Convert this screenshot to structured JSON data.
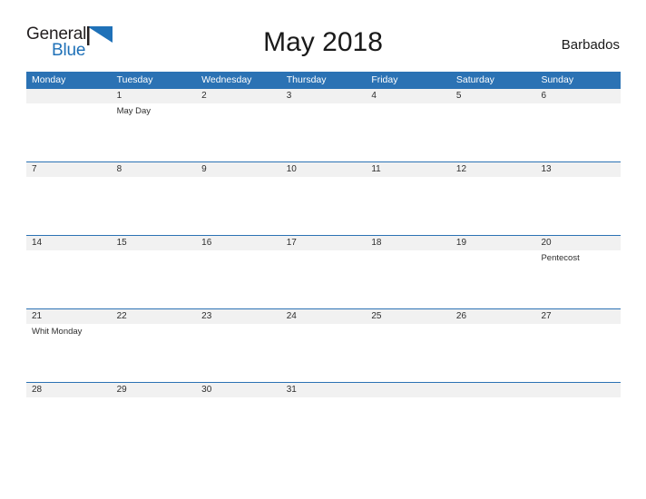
{
  "brand": {
    "name_part1": "General",
    "name_part2": "Blue",
    "color_dark": "#231f20",
    "color_blue": "#1f71b8"
  },
  "header": {
    "title": "May 2018",
    "country": "Barbados"
  },
  "theme": {
    "header_band": "#2b72b4",
    "daynum_band": "#f1f1f1",
    "row_divider": "#2b72b4",
    "text": "#2e2e2e",
    "header_text": "#ffffff"
  },
  "calendar": {
    "weekdays": [
      "Monday",
      "Tuesday",
      "Wednesday",
      "Thursday",
      "Friday",
      "Saturday",
      "Sunday"
    ],
    "weeks": [
      {
        "days": [
          {
            "num": "",
            "event": ""
          },
          {
            "num": "1",
            "event": "May Day"
          },
          {
            "num": "2",
            "event": ""
          },
          {
            "num": "3",
            "event": ""
          },
          {
            "num": "4",
            "event": ""
          },
          {
            "num": "5",
            "event": ""
          },
          {
            "num": "6",
            "event": ""
          }
        ]
      },
      {
        "days": [
          {
            "num": "7",
            "event": ""
          },
          {
            "num": "8",
            "event": ""
          },
          {
            "num": "9",
            "event": ""
          },
          {
            "num": "10",
            "event": ""
          },
          {
            "num": "11",
            "event": ""
          },
          {
            "num": "12",
            "event": ""
          },
          {
            "num": "13",
            "event": ""
          }
        ]
      },
      {
        "days": [
          {
            "num": "14",
            "event": ""
          },
          {
            "num": "15",
            "event": ""
          },
          {
            "num": "16",
            "event": ""
          },
          {
            "num": "17",
            "event": ""
          },
          {
            "num": "18",
            "event": ""
          },
          {
            "num": "19",
            "event": ""
          },
          {
            "num": "20",
            "event": "Pentecost"
          }
        ]
      },
      {
        "days": [
          {
            "num": "21",
            "event": "Whit Monday"
          },
          {
            "num": "22",
            "event": ""
          },
          {
            "num": "23",
            "event": ""
          },
          {
            "num": "24",
            "event": ""
          },
          {
            "num": "25",
            "event": ""
          },
          {
            "num": "26",
            "event": ""
          },
          {
            "num": "27",
            "event": ""
          }
        ]
      },
      {
        "days": [
          {
            "num": "28",
            "event": ""
          },
          {
            "num": "29",
            "event": ""
          },
          {
            "num": "30",
            "event": ""
          },
          {
            "num": "31",
            "event": ""
          },
          {
            "num": "",
            "event": ""
          },
          {
            "num": "",
            "event": ""
          },
          {
            "num": "",
            "event": ""
          }
        ]
      }
    ]
  }
}
